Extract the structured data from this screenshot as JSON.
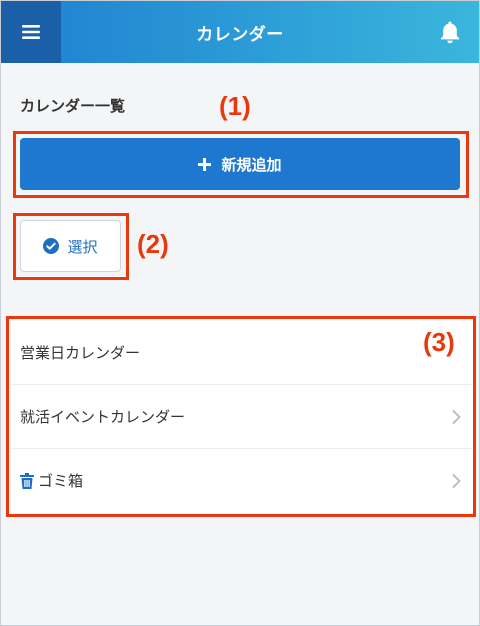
{
  "header": {
    "title": "カレンダー"
  },
  "section": {
    "title": "カレンダー一覧"
  },
  "add_button": {
    "label": "新規追加"
  },
  "select_button": {
    "label": "選択"
  },
  "list": {
    "items": [
      {
        "label": "営業日カレンダー"
      },
      {
        "label": "就活イベントカレンダー"
      },
      {
        "label": "ゴミ箱"
      }
    ]
  },
  "annotations": {
    "a1": "(1)",
    "a2": "(2)",
    "a3": "(3)"
  },
  "colors": {
    "header_dark": "#1b5fa8",
    "accent": "#1e78cf",
    "annotation": "#e8380d"
  },
  "icons": [
    "hamburger-icon",
    "bell-icon",
    "plus-icon",
    "check-circle-icon",
    "trash-icon",
    "chevron-right-icon"
  ]
}
